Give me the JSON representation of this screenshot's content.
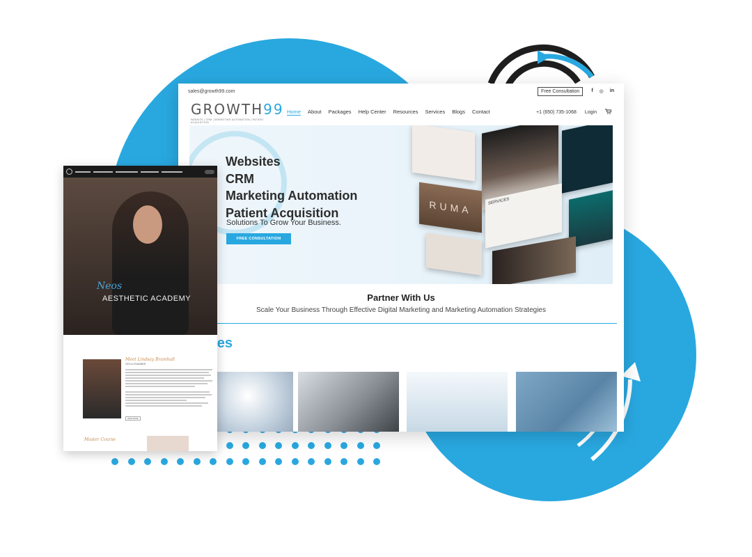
{
  "main_site": {
    "topbar": {
      "email": "sales@growth99.com",
      "cta": "Free Consultation",
      "social": [
        "f",
        "◎",
        "in"
      ]
    },
    "logo": {
      "word": "GROWTH",
      "word_accent": "99",
      "tagline": "WEBSITE | CRM | MARKETING AUTOMATION | PATIENT ACQUISITION"
    },
    "nav": [
      "Home",
      "About",
      "Packages",
      "Help Center",
      "Resources",
      "Services",
      "Blogs",
      "Contact"
    ],
    "phone": "+1 (650) 735-1068",
    "login": "Login",
    "cart_icon": "cart-icon",
    "hero": {
      "lines": [
        "Websites",
        "CRM",
        "Marketing Automation",
        "Patient Acquisition"
      ],
      "subtitle": "Solutions To Grow Your Business.",
      "button": "FREE CONSULTATION",
      "mockup_texts": [
        "RUMA",
        "SERVICES"
      ]
    },
    "partner": {
      "title": "Partner With Us",
      "subtitle": "Scale Your Business Through Effective Digital Marketing and Marketing Automation Strategies"
    },
    "services_title": "vices"
  },
  "overlay_site": {
    "hero_script": "Neos",
    "hero_title": "AESTHETIC ACADEMY",
    "about_heading": "Meet Lindsay Bramhall",
    "about_role": "CEO & FOUNDER",
    "read_more": "READ MORE",
    "course_heading": "Master Course"
  },
  "colors": {
    "brand_blue": "#29a8e0",
    "dark": "#2c2c2c"
  }
}
